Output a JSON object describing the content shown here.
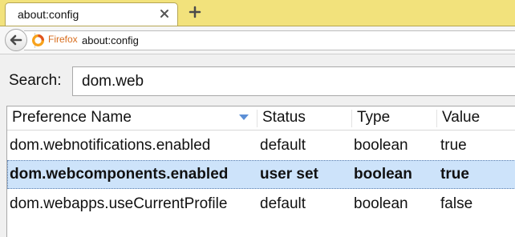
{
  "tab": {
    "title": "about:config"
  },
  "navbar": {
    "identity_label": "Firefox",
    "url": "about:config"
  },
  "search": {
    "label": "Search:",
    "value": "dom.web"
  },
  "table": {
    "columns": [
      "Preference Name",
      "Status",
      "Type",
      "Value"
    ],
    "rows": [
      {
        "name": "dom.webnotifications.enabled",
        "status": "default",
        "type": "boolean",
        "value": "true",
        "selected": false
      },
      {
        "name": "dom.webcomponents.enabled",
        "status": "user set",
        "type": "boolean",
        "value": "true",
        "selected": true
      },
      {
        "name": "dom.webapps.useCurrentProfile",
        "status": "default",
        "type": "boolean",
        "value": "false",
        "selected": false
      }
    ]
  },
  "colors": {
    "tabstrip": "#f2e27c",
    "selection": "#cde3fa",
    "identity_text": "#d86d1d"
  },
  "icons": [
    "close-icon",
    "plus-icon",
    "back-arrow-icon",
    "firefox-logo-icon",
    "sort-descending-icon"
  ]
}
